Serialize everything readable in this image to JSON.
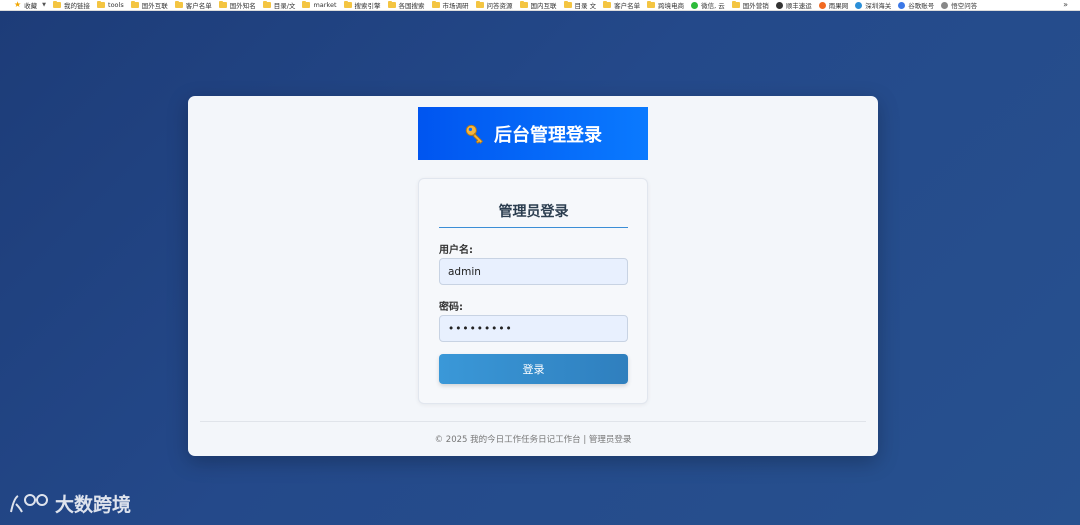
{
  "bookmarks": {
    "items": [
      {
        "label": "收藏",
        "icon": "star-icon"
      },
      {
        "label": "我的链接",
        "icon": "folder-icon"
      },
      {
        "label": "tools",
        "icon": "folder-icon"
      },
      {
        "label": "国外互联",
        "icon": "folder-icon"
      },
      {
        "label": "客户名单",
        "icon": "folder-icon"
      },
      {
        "label": "国外知名",
        "icon": "folder-icon"
      },
      {
        "label": "目录/文",
        "icon": "folder-icon"
      },
      {
        "label": "market",
        "icon": "folder-icon"
      },
      {
        "label": "搜索引擎",
        "icon": "folder-icon"
      },
      {
        "label": "各国搜索",
        "icon": "folder-icon"
      },
      {
        "label": "市场调研",
        "icon": "folder-icon"
      },
      {
        "label": "问答资源",
        "icon": "folder-icon"
      },
      {
        "label": "国内互联",
        "icon": "folder-icon"
      },
      {
        "label": "目录 文",
        "icon": "folder-icon"
      },
      {
        "label": "客户名单",
        "icon": "folder-icon"
      },
      {
        "label": "跨境电商",
        "icon": "folder-icon"
      },
      {
        "label": "微信, 云",
        "icon": "wechat-icon",
        "color": "#2dbb3a"
      },
      {
        "label": "国外营销",
        "icon": "folder-icon"
      },
      {
        "label": "顺丰速运",
        "icon": "sf-icon",
        "color": "#333333"
      },
      {
        "label": "雨果网",
        "icon": "cifnews-icon",
        "color": "#f26a21"
      },
      {
        "label": "深圳海关",
        "icon": "customs-icon",
        "color": "#2a8fd8"
      },
      {
        "label": "谷歌账号",
        "icon": "google-icon",
        "color": "#3b78e7"
      },
      {
        "label": "悟空问答",
        "icon": "wukong-icon",
        "color": "#888888"
      }
    ],
    "more": "»"
  },
  "banner": {
    "title": "后台管理登录",
    "icon": "key-icon"
  },
  "login": {
    "title": "管理员登录",
    "username_label": "用户名:",
    "username_value": "admin",
    "password_label": "密码:",
    "password_value": "•••••••••",
    "submit_label": "登录"
  },
  "footer": {
    "text": "© 2025 我的今日工作任务日记工作台 | 管理员登录"
  },
  "watermark": {
    "text": "大数跨境",
    "logo": "dashu-logo"
  },
  "colors": {
    "background": "#24498a",
    "banner": "#0a6cff",
    "button": "#3a98d8",
    "underline": "#3b8ed6"
  }
}
